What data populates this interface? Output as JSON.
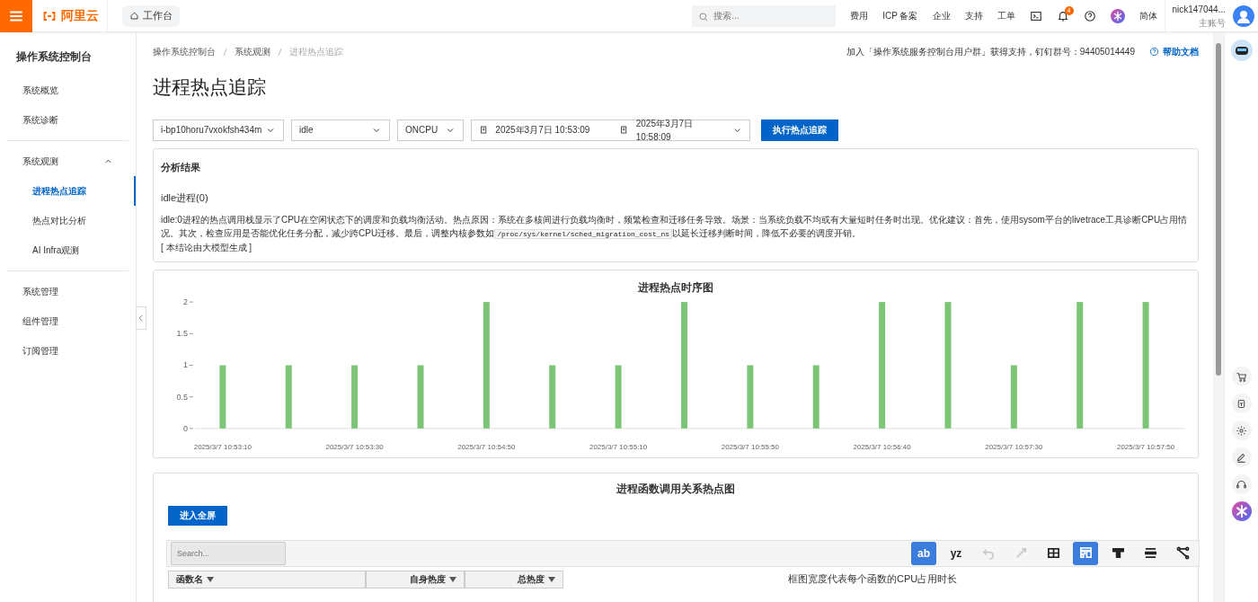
{
  "topbar": {
    "logo_text": "阿里云",
    "workbench": "工作台",
    "search_placeholder": "搜索...",
    "links": [
      "费用",
      "ICP 备案",
      "企业",
      "支持",
      "工单"
    ],
    "notification_count": "4",
    "language": "简体",
    "user": {
      "name": "nick147044...",
      "role": "主账号"
    }
  },
  "sidebar": {
    "title": "操作系统控制台",
    "sections": [
      {
        "items": [
          {
            "kind": "link",
            "label": "系统概览",
            "selected": false
          },
          {
            "kind": "link",
            "label": "系统诊断",
            "selected": false
          }
        ]
      },
      {
        "items": [
          {
            "kind": "group",
            "label": "系统观测",
            "selected": false,
            "expanded": true,
            "children": [
              {
                "label": "进程热点追踪",
                "selected": true
              },
              {
                "label": "热点对比分析",
                "selected": false
              },
              {
                "label": "AI Infra观测",
                "selected": false
              }
            ]
          }
        ]
      },
      {
        "items": [
          {
            "kind": "link",
            "label": "系统管理",
            "selected": false
          },
          {
            "kind": "link",
            "label": "组件管理",
            "selected": false
          },
          {
            "kind": "link",
            "label": "订阅管理",
            "selected": false
          }
        ]
      }
    ]
  },
  "breadcrumb": [
    "操作系统控制台",
    "系统观测",
    "进程热点追踪"
  ],
  "notice": {
    "text": "加入「操作系统服务控制台用户群」获得支持，钉钉群号：94405014449",
    "help": "帮助文档"
  },
  "page_title": "进程热点追踪",
  "filters": {
    "instance": "i-bp10horu7vxokfsh434m",
    "process": "idle",
    "mode": "ONCPU",
    "start": "2025年3月7日 10:53:09",
    "end": "2025年3月7日 10:58:09",
    "button": "执行热点追踪"
  },
  "result": {
    "title": "分析结果",
    "heading": "idle进程(0)",
    "text_before": "idle:0进程的热点调用栈显示了CPU在空闲状态下的调度和负载均衡活动。热点原因：系统在多核间进行负载均衡时，频繁检查和迁移任务导致。场景：当系统负载不均或有大量短时任务时出现。优化建议：首先，使用sysom平台的livetrace工具诊断CPU占用情况。其次，检查应用是否能优化任务分配，减少跨CPU迁移。最后，调整内核参数如",
    "code": "/proc/sys/kernel/sched_migration_cost_ns",
    "text_after": "以延长迁移判断时间，降低不必要的调度开销。",
    "note": "[ 本结论由大模型生成 ]"
  },
  "timeline": {
    "chart_data": {
      "type": "bar",
      "title": "进程热点时序图",
      "ylim": [
        0,
        2
      ],
      "yticks": [
        0,
        0.5,
        1,
        1.5,
        2
      ],
      "categories": [
        "2025/3/7 10:53:10",
        null,
        "2025/3/7 10:53:30",
        null,
        "2025/3/7 10:54:50",
        null,
        "2025/3/7 10:55:10",
        null,
        "2025/3/7 10:55:50",
        null,
        "2025/3/7 10:56:40",
        null,
        "2025/3/7 10:57:30",
        null,
        "2025/3/7 10:57:50"
      ],
      "series": [
        {
          "color": "#7cc576",
          "values": [
            1,
            1,
            1,
            1,
            2,
            1,
            1,
            2,
            1,
            1,
            2,
            2,
            1,
            2,
            2
          ]
        }
      ]
    }
  },
  "flame": {
    "title": "进程函数调用关系热点图",
    "fullscreen_button": "进入全屏",
    "search_placeholder": "Search...",
    "tools": [
      {
        "kind": "text",
        "label": "ab",
        "selected": true,
        "disabled": false
      },
      {
        "kind": "text",
        "label": "yz",
        "selected": false,
        "disabled": false
      },
      {
        "kind": "undo",
        "selected": false,
        "disabled": true
      },
      {
        "kind": "redo",
        "selected": false,
        "disabled": true
      },
      {
        "kind": "table",
        "selected": false,
        "disabled": false
      },
      {
        "kind": "flame",
        "selected": true,
        "disabled": false
      },
      {
        "kind": "icicle",
        "selected": false,
        "disabled": false
      },
      {
        "kind": "sandwich",
        "selected": false,
        "disabled": false
      },
      {
        "kind": "graph",
        "selected": false,
        "disabled": false
      }
    ],
    "columns": [
      "函数名",
      "自身热度",
      "总热度"
    ],
    "caption": "框图宽度代表每个函数的CPU占用时长"
  }
}
